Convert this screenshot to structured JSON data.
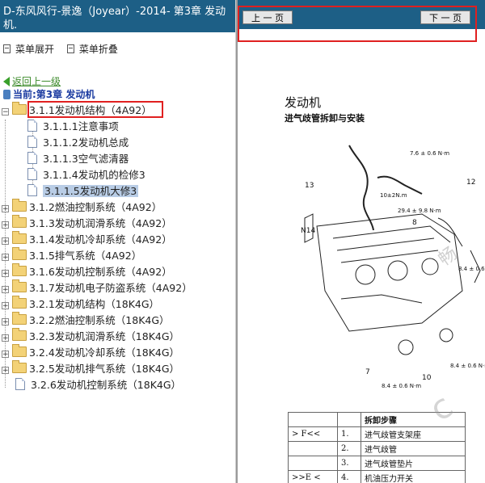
{
  "left": {
    "title": "D-东风风行-景逸（Joyear）-2014- 第3章 发动机.",
    "menu_expand": "菜单展开",
    "menu_collapse": "菜单折叠",
    "back_link": "返回上一级",
    "current_label": "当前:第3章 发动机",
    "tree": {
      "root": "3.1.1发动机结构（4A92）",
      "children": [
        "3.1.1.1注意事项",
        "3.1.1.2发动机总成",
        "3.1.1.3空气滤清器",
        "3.1.1.4发动机的检修3",
        "3.1.1.5发动机大修3"
      ],
      "siblings": [
        "3.1.2燃油控制系统（4A92）",
        "3.1.3发动机润滑系统（4A92）",
        "3.1.4发动机冷却系统（4A92）",
        "3.1.5排气系统（4A92）",
        "3.1.6发动机控制系统（4A92）",
        "3.1.7发动机电子防盗系统（4A92）",
        "3.2.1发动机结构（18K4G）",
        "3.2.2燃油控制系统（18K4G）",
        "3.2.3发动机润滑系统（18K4G）",
        "3.2.4发动机冷却系统（18K4G）",
        "3.2.5发动机排气系统（18K4G）",
        "3.2.6发动机控制系统（18K4G）"
      ]
    }
  },
  "right": {
    "prev_page": "上 一 页",
    "next_page": "下 一 页",
    "section_title": "发动机",
    "section_subtitle": "进气歧管拆卸与安装",
    "diagram_labels": {
      "n13": "13",
      "n12": "12",
      "n14": "N14",
      "n7": "7",
      "n10": "10",
      "n8": "8",
      "t1": "7.6 ± 0.6 N·m",
      "t2": "10±2N.m",
      "t3": "29.4 ± 9.8 N·m",
      "t4": "8.4 ± 0.6 N·m",
      "t5": "8.4 ± 0.6 N·m",
      "t6": "8.4 ± 0.6 N·m"
    },
    "table": {
      "header": "拆卸步骤",
      "rows": [
        {
          "mark": "> F<<",
          "no": "1.",
          "name": "进气歧管支架座"
        },
        {
          "mark": "",
          "no": "2.",
          "name": "进气歧管"
        },
        {
          "mark": "",
          "no": "3.",
          "name": "进气歧管垫片"
        },
        {
          "mark": ">>E <",
          "no": "4.",
          "name": "机油压力开关"
        }
      ]
    }
  }
}
